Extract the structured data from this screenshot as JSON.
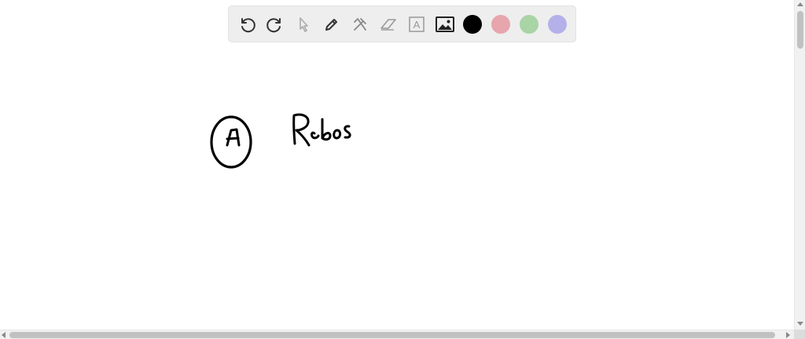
{
  "toolbar": {
    "tools": [
      {
        "name": "undo-icon"
      },
      {
        "name": "redo-icon"
      },
      {
        "name": "pointer-icon"
      },
      {
        "name": "pen-icon"
      },
      {
        "name": "tools-icon"
      },
      {
        "name": "eraser-icon"
      },
      {
        "name": "text-icon",
        "glyph": "A"
      },
      {
        "name": "image-icon"
      }
    ],
    "colors": [
      "#000000",
      "#e7a5ae",
      "#a9d4a6",
      "#b4b1ea"
    ]
  },
  "canvas": {
    "handwriting": {
      "label": "A",
      "word": "Rebos"
    }
  }
}
